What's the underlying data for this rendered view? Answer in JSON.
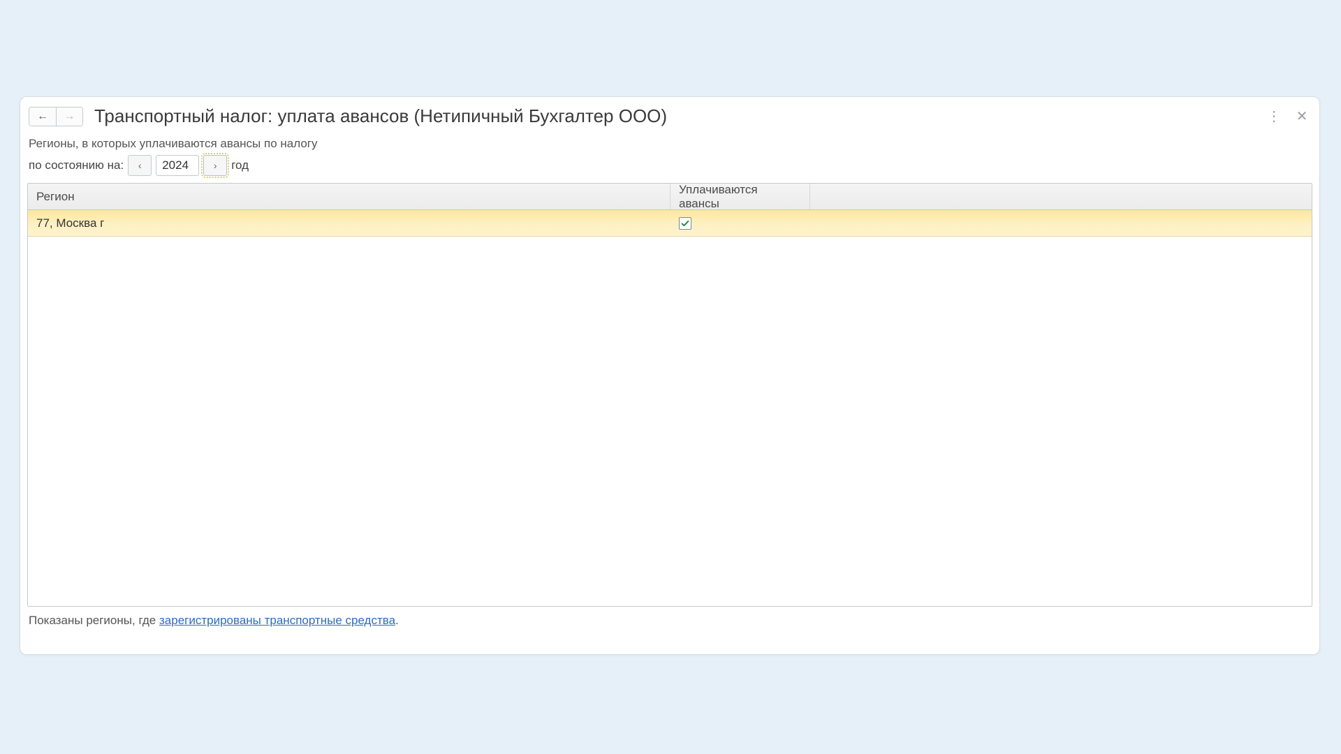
{
  "title": "Транспортный налог: уплата авансов (Нетипичный Бухгалтер ООО)",
  "subtitle": "Регионы, в которых уплачиваются авансы по налогу",
  "filter": {
    "prefix": "по состоянию на:",
    "year": "2024",
    "suffix": "год"
  },
  "columns": {
    "region": "Регион",
    "advances": "Уплачиваются авансы"
  },
  "rows": [
    {
      "region": "77, Москва г",
      "advances_checked": true
    }
  ],
  "footer": {
    "prefix": "Показаны регионы, где ",
    "link": "зарегистрированы транспортные средства",
    "suffix": "."
  }
}
